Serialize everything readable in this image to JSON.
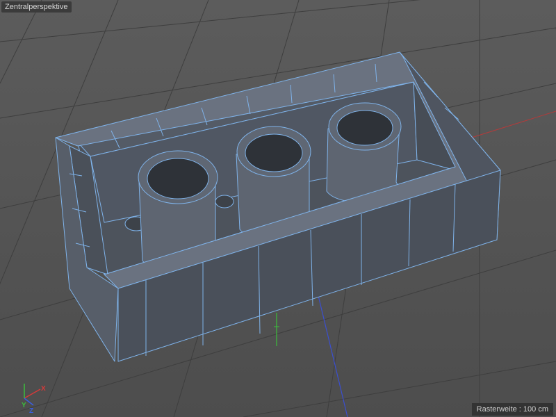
{
  "viewport": {
    "title": "Zentralperspektive",
    "grid_info": "Rasterweite : 100 cm"
  },
  "axis_gizmo": {
    "x_label": "X",
    "y_label": "Y",
    "z_label": "Z",
    "x_color": "#d63a3a",
    "y_color": "#3bbf3b",
    "z_color": "#3a5fe0"
  },
  "colors": {
    "mesh_face": "#5d6470",
    "mesh_edge": "#7fb3ea",
    "grid_line": "#3e3e3e"
  },
  "scene_icons": [
    "world-axis-x-line",
    "world-axis-y-line",
    "world-axis-z-line",
    "brick-mesh"
  ]
}
